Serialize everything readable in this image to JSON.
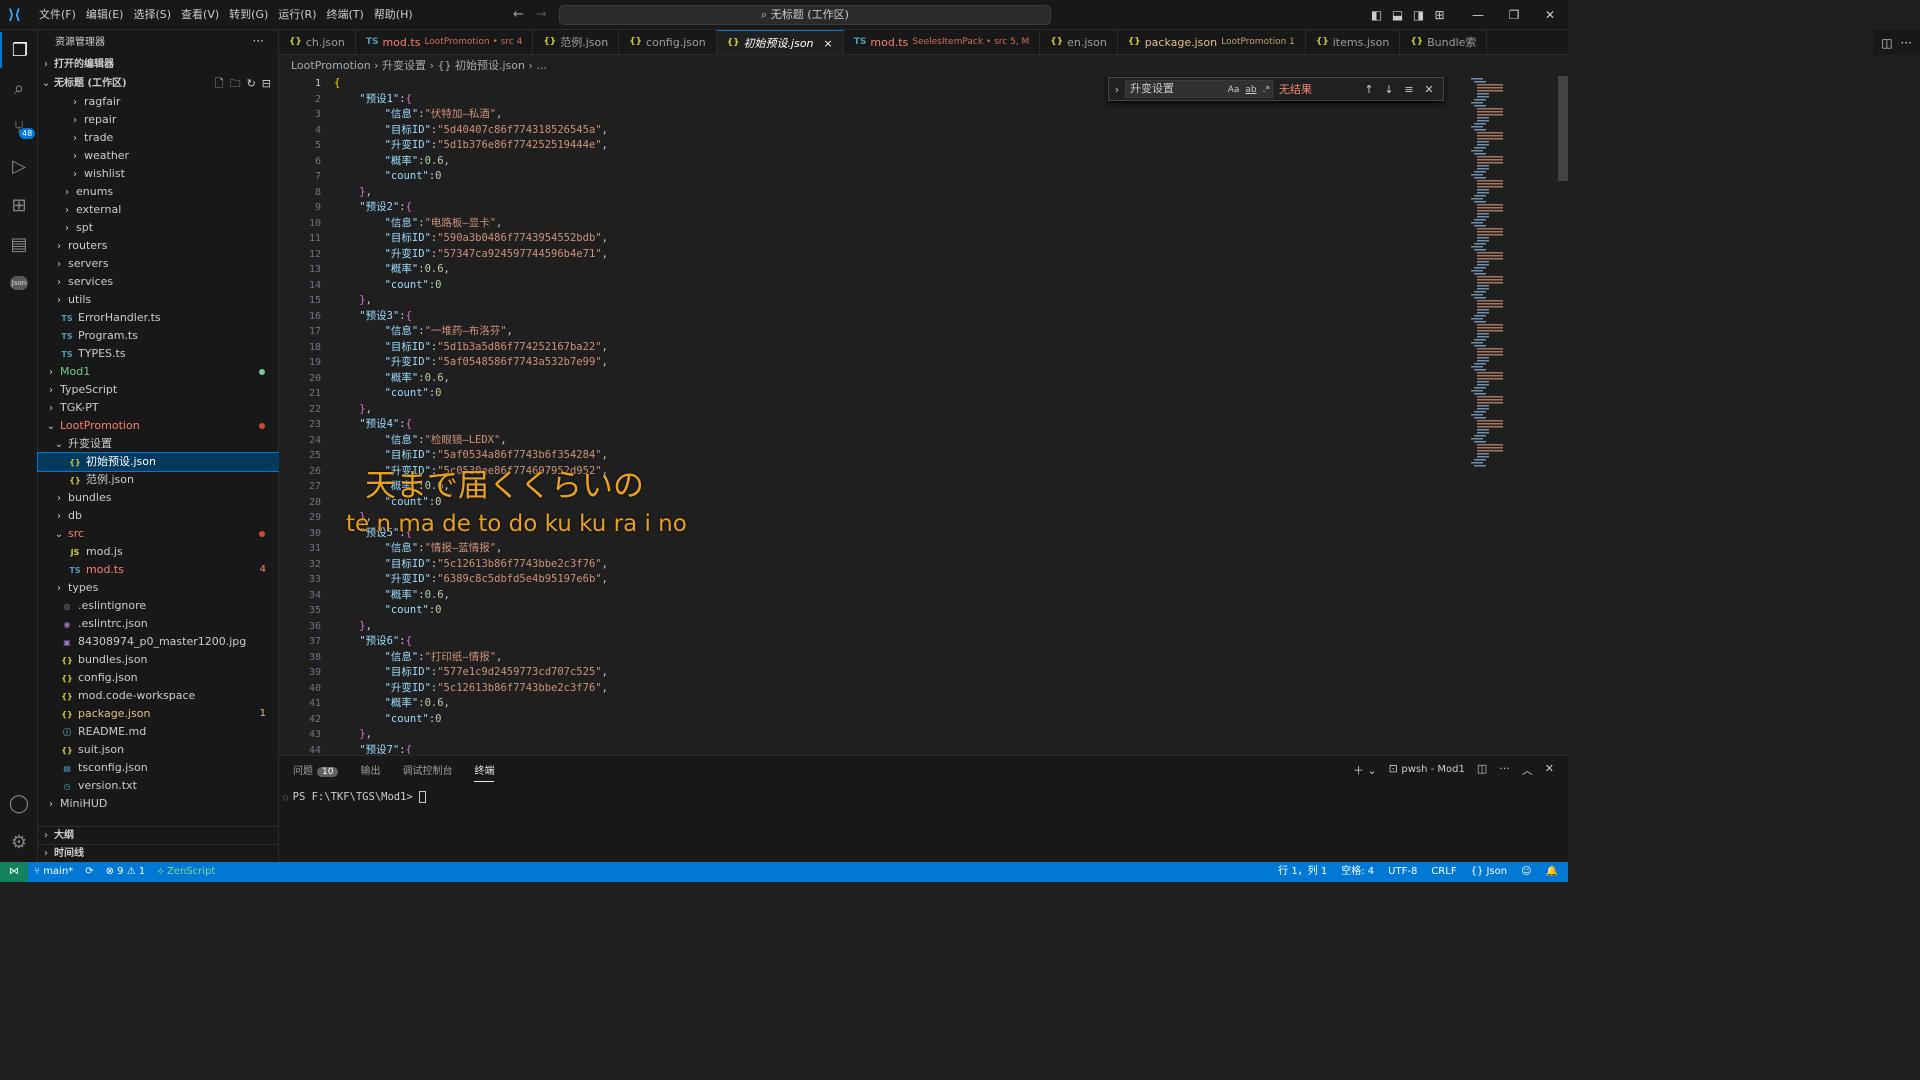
{
  "menu": [
    "文件(F)",
    "编辑(E)",
    "选择(S)",
    "查看(V)",
    "转到(G)",
    "运行(R)",
    "终端(T)",
    "帮助(H)"
  ],
  "search_label": "无标题 (工作区)",
  "sidebar": {
    "title": "资源管理器",
    "open_editors": "打开的编辑器",
    "workspace": "无标题 (工作区)",
    "outline": "大纲",
    "timeline": "时间线",
    "tree": [
      {
        "label": "ragfair",
        "indent": 3,
        "twisty": "›",
        "kind": "folder"
      },
      {
        "label": "repair",
        "indent": 3,
        "twisty": "›",
        "kind": "folder"
      },
      {
        "label": "trade",
        "indent": 3,
        "twisty": "›",
        "kind": "folder"
      },
      {
        "label": "weather",
        "indent": 3,
        "twisty": "›",
        "kind": "folder"
      },
      {
        "label": "wishlist",
        "indent": 3,
        "twisty": "›",
        "kind": "folder"
      },
      {
        "label": "enums",
        "indent": 2,
        "twisty": "›",
        "kind": "folder"
      },
      {
        "label": "external",
        "indent": 2,
        "twisty": "›",
        "kind": "folder"
      },
      {
        "label": "spt",
        "indent": 2,
        "twisty": "›",
        "kind": "folder"
      },
      {
        "label": "routers",
        "indent": 1,
        "twisty": "›",
        "kind": "folder"
      },
      {
        "label": "servers",
        "indent": 1,
        "twisty": "›",
        "kind": "folder"
      },
      {
        "label": "services",
        "indent": 1,
        "twisty": "›",
        "kind": "folder"
      },
      {
        "label": "utils",
        "indent": 1,
        "twisty": "›",
        "kind": "folder"
      },
      {
        "label": "ErrorHandler.ts",
        "indent": 1,
        "icon": "TS",
        "iconColor": "#519aba",
        "kind": "file"
      },
      {
        "label": "Program.ts",
        "indent": 1,
        "icon": "TS",
        "iconColor": "#519aba",
        "kind": "file"
      },
      {
        "label": "TYPES.ts",
        "indent": 1,
        "icon": "TS",
        "iconColor": "#519aba",
        "kind": "file"
      },
      {
        "label": "Mod1",
        "indent": 0,
        "twisty": "›",
        "kind": "folder",
        "color": "#73c991",
        "dot": "#73c991"
      },
      {
        "label": "TypeScript",
        "indent": 0,
        "twisty": "›",
        "kind": "folder"
      },
      {
        "label": "TGK-PT",
        "indent": 0,
        "twisty": "›",
        "kind": "folder"
      },
      {
        "label": "LootPromotion",
        "indent": 0,
        "twisty": "⌄",
        "kind": "folder",
        "color": "#f88070",
        "dot": "#c74e39"
      },
      {
        "label": "升变设置",
        "indent": 1,
        "twisty": "⌄",
        "kind": "folder"
      },
      {
        "label": "初始预设.json",
        "indent": 2,
        "icon": "{}",
        "iconColor": "#cbcb41",
        "kind": "file",
        "selected": true,
        "color": "#ffffff"
      },
      {
        "label": "范例.json",
        "indent": 2,
        "icon": "{}",
        "iconColor": "#cbcb41",
        "kind": "file"
      },
      {
        "label": "bundles",
        "indent": 1,
        "twisty": "›",
        "kind": "folder"
      },
      {
        "label": "db",
        "indent": 1,
        "twisty": "›",
        "kind": "folder"
      },
      {
        "label": "src",
        "indent": 1,
        "twisty": "⌄",
        "kind": "folder",
        "color": "#f88070",
        "dot": "#c74e39"
      },
      {
        "label": "mod.js",
        "indent": 2,
        "icon": "JS",
        "iconColor": "#cbcb41",
        "kind": "file"
      },
      {
        "label": "mod.ts",
        "indent": 2,
        "icon": "TS",
        "iconColor": "#519aba",
        "kind": "file",
        "color": "#f88070",
        "count": "4"
      },
      {
        "label": "types",
        "indent": 1,
        "twisty": "›",
        "kind": "folder"
      },
      {
        "label": ".eslintignore",
        "indent": 1,
        "icon": "◎",
        "iconColor": "#8b8b8b",
        "kind": "file"
      },
      {
        "label": ".eslintrc.json",
        "indent": 1,
        "icon": "◉",
        "iconColor": "#a074c4",
        "kind": "file"
      },
      {
        "label": "84308974_p0_master1200.jpg",
        "indent": 1,
        "icon": "▣",
        "iconColor": "#a074c4",
        "kind": "file"
      },
      {
        "label": "bundles.json",
        "indent": 1,
        "icon": "{}",
        "iconColor": "#cbcb41",
        "kind": "file"
      },
      {
        "label": "config.json",
        "indent": 1,
        "icon": "{}",
        "iconColor": "#cbcb41",
        "kind": "file"
      },
      {
        "label": "mod.code-workspace",
        "indent": 1,
        "icon": "{}",
        "iconColor": "#cbcb41",
        "kind": "file"
      },
      {
        "label": "package.json",
        "indent": 1,
        "icon": "{}",
        "iconColor": "#cbcb41",
        "kind": "file",
        "color": "#e2c08d",
        "count": "1",
        "countColor": "#e2c08d"
      },
      {
        "label": "README.md",
        "indent": 1,
        "icon": "ⓘ",
        "iconColor": "#519aba",
        "kind": "file"
      },
      {
        "label": "suit.json",
        "indent": 1,
        "icon": "{}",
        "iconColor": "#cbcb41",
        "kind": "file"
      },
      {
        "label": "tsconfig.json",
        "indent": 1,
        "icon": "▤",
        "iconColor": "#519aba",
        "kind": "file"
      },
      {
        "label": "version.txt",
        "indent": 1,
        "icon": "◷",
        "iconColor": "#519aba",
        "kind": "file"
      },
      {
        "label": "MiniHUD",
        "indent": 0,
        "twisty": "›",
        "kind": "folder"
      }
    ]
  },
  "tabs": [
    {
      "icon": "{}",
      "iconColor": "#cbcb41",
      "label": "ch.json",
      "desc": ""
    },
    {
      "icon": "TS",
      "iconColor": "#519aba",
      "label": "mod.ts",
      "desc": "LootPromotion • src 4",
      "color": "#f88070"
    },
    {
      "icon": "{}",
      "iconColor": "#cbcb41",
      "label": "范例.json",
      "desc": ""
    },
    {
      "icon": "{}",
      "iconColor": "#cbcb41",
      "label": "config.json",
      "desc": ""
    },
    {
      "icon": "{}",
      "iconColor": "#cbcb41",
      "label": "初始预设.json",
      "desc": "",
      "active": true,
      "close": "×"
    },
    {
      "icon": "TS",
      "iconColor": "#519aba",
      "label": "mod.ts",
      "desc": "SeelesItemPack • src 5, M",
      "color": "#f88070"
    },
    {
      "icon": "{}",
      "iconColor": "#cbcb41",
      "label": "en.json",
      "desc": ""
    },
    {
      "icon": "{}",
      "iconColor": "#cbcb41",
      "label": "package.json",
      "desc": "LootPromotion 1",
      "color": "#e2c08d"
    },
    {
      "icon": "{}",
      "iconColor": "#cbcb41",
      "label": "items.json",
      "desc": ""
    },
    {
      "icon": "{}",
      "iconColor": "#cbcb41",
      "label": "Bundle索",
      "desc": ""
    }
  ],
  "breadcrumb": "LootPromotion  ›  升变设置  ›  {} 初始预设.json  ›  ...",
  "find": {
    "query": "升变设置",
    "case": "Aa",
    "word": "ab",
    "regex": ".*",
    "result": "无结果"
  },
  "code": {
    "presets": [
      {
        "key": "预设1",
        "info": "伏特加—私酒",
        "target": "5d40407c86f774318526545a",
        "upgrade": "5d1b376e86f774252519444e",
        "prob": "0.6",
        "count": "0"
      },
      {
        "key": "预设2",
        "info": "电路板—显卡",
        "target": "590a3b0486f7743954552bdb",
        "upgrade": "57347ca924597744596b4e71",
        "prob": "0.6",
        "count": "0"
      },
      {
        "key": "预设3",
        "info": "一堆药—布洛芬",
        "target": "5d1b3a5d86f774252167ba22",
        "upgrade": "5af0548586f7743a532b7e99",
        "prob": "0.6",
        "count": "0"
      },
      {
        "key": "预设4",
        "info": "检眼镜—LEDX",
        "target": "5af0534a86f7743b6f354284",
        "upgrade": "5c0530ee86f774697952d952",
        "prob": "0.6",
        "count": "0"
      },
      {
        "key": "预设5",
        "info": "情报—蓝情报",
        "target": "5c12613b86f7743bbe2c3f76",
        "upgrade": "6389c8c5dbfd5e4b95197e6b",
        "prob": "0.6",
        "count": "0"
      },
      {
        "key": "预设6",
        "info": "打印纸—情报",
        "target": "577e1c9d2459773cd707c525",
        "upgrade": "5c12613b86f7743bbe2c3f76",
        "prob": "0.6",
        "count": "0"
      },
      {
        "key": "预设7",
        "info": "",
        "target": "",
        "upgrade": "",
        "prob": "",
        "count": ""
      }
    ],
    "labels": {
      "info": "信息",
      "target": "目标ID",
      "upgrade": "升变ID",
      "prob": "概率",
      "count": "count"
    }
  },
  "overlay": {
    "jp": "天まで届くくらいの",
    "romaji": "te n ma de to do ku ku ra i no"
  },
  "panel": {
    "tabs": [
      "问题",
      "输出",
      "调试控制台",
      "终端"
    ],
    "problems_count": "10",
    "terminal_name": "pwsh - Mod1",
    "prompt": "PS F:\\TKF\\TGS\\Mod1>"
  },
  "status": {
    "branch": "main*",
    "errors": "⊗ 9",
    "warnings": "⚠ 1",
    "zenscript": "ZenScript",
    "position": "行 1，列 1",
    "spaces": "空格: 4",
    "encoding": "UTF-8",
    "eol": "CRLF",
    "lang": "{} Json"
  },
  "colors": {
    "accent": "#0078d4",
    "statusbar": "#0078d4",
    "remote": "#16825d",
    "overlay_text": "#e8a020"
  }
}
